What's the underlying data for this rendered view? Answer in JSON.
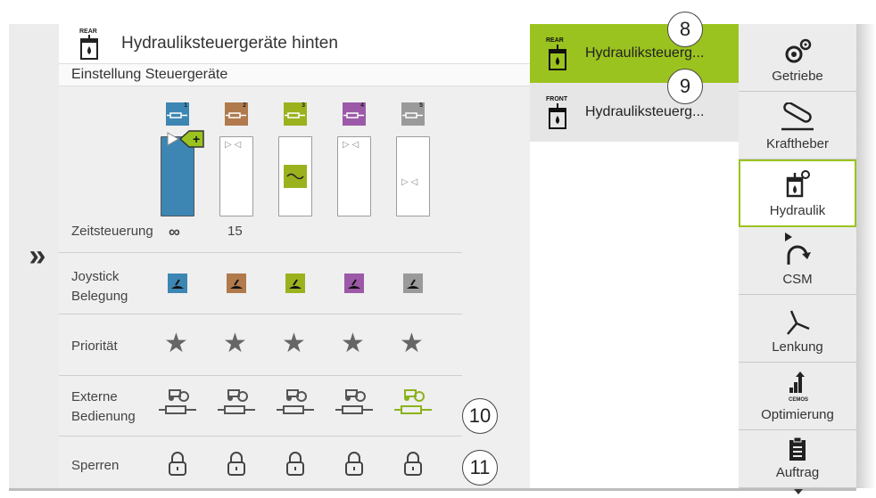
{
  "header": {
    "icon": "hydraulic-rear-icon",
    "icon_tag": "REAR",
    "title": "Hydrauliksteuergeräte hinten"
  },
  "subheader": "Einstellung Steuergeräte",
  "expander_glyph": "»",
  "rows": {
    "zeitsteuerung": "Zeitsteuerung",
    "joystick": "Joystick\nBelegung",
    "joystick_line1": "Joystick",
    "joystick_line2": "Belegung",
    "prioritaet": "Priorität",
    "externe_line1": "Externe",
    "externe_line2": "Bedienung",
    "sperren": "Sperren"
  },
  "valves": [
    {
      "number": "1",
      "color": "#3d86b4",
      "time": "∞",
      "fill": 1.0,
      "joystick_icon": "joystick-fwd-icon",
      "external_active": false
    },
    {
      "number": "2",
      "color": "#b07a4c",
      "time": "15",
      "fill": 0.0,
      "joystick_icon": "joystick-fwd-icon",
      "external_active": false
    },
    {
      "number": "3",
      "color": "#9bb21e",
      "time": "",
      "fill": 0.0,
      "joystick_icon": "joystick-fwd-icon",
      "external_active": false
    },
    {
      "number": "4",
      "color": "#9b59a8",
      "time": "",
      "fill": 0.0,
      "joystick_icon": "joystick-updown-icon",
      "external_active": false
    },
    {
      "number": "5",
      "color": "#9a9a9a",
      "time": "",
      "fill": 0.0,
      "joystick_icon": "joystick-leftright-icon",
      "external_active": true
    }
  ],
  "callouts": {
    "c8": "8",
    "c9": "9",
    "c10": "10",
    "c11": "11"
  },
  "list": [
    {
      "tag": "REAR",
      "label": "Hydrauliksteuerg...",
      "selected": true
    },
    {
      "tag": "FRONT",
      "label": "Hydrauliksteuerg...",
      "selected": false
    }
  ],
  "nav": [
    {
      "label": "Getriebe",
      "icon": "gears-icon"
    },
    {
      "label": "Kraftheber",
      "icon": "lift-icon"
    },
    {
      "label": "Hydraulik",
      "icon": "hydraulic-icon",
      "active": true
    },
    {
      "label": "CSM",
      "icon": "csm-turn-icon"
    },
    {
      "label": "Lenkung",
      "icon": "steering-icon"
    },
    {
      "label": "Optimierung",
      "icon": "cemos-icon",
      "sub": "CEMOS"
    },
    {
      "label": "Auftrag",
      "icon": "clipboard-icon"
    }
  ],
  "colors": {
    "accent": "#9bc31f",
    "panel": "#efefef",
    "nav": "#ececec"
  }
}
